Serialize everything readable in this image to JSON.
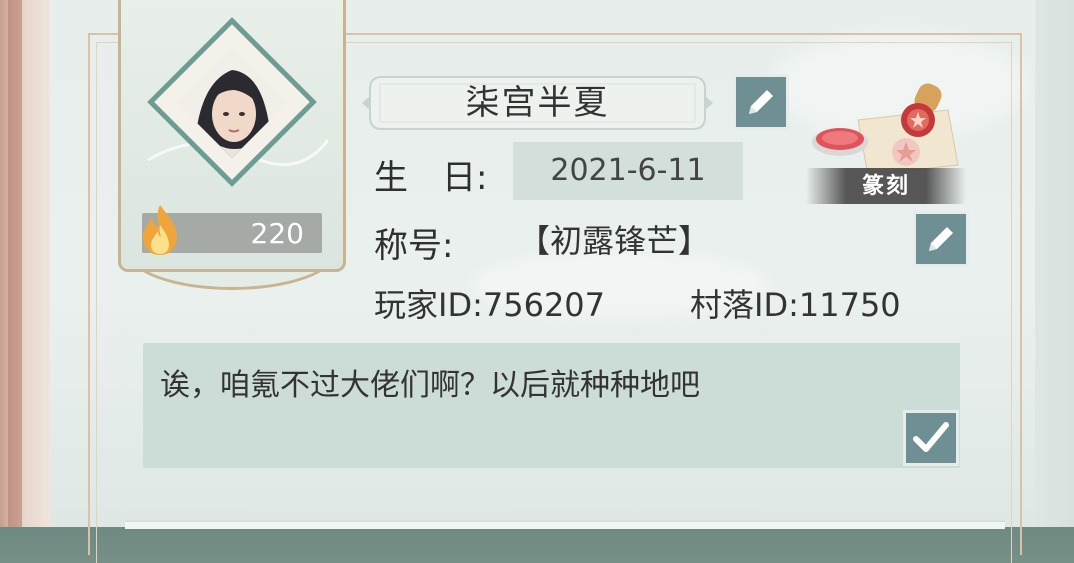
{
  "profile": {
    "name": "柒宫半夏",
    "level": "220",
    "birthday_label": "生　日:",
    "birthday": "2021-6-11",
    "title_label": "称号:",
    "title": "【初露锋芒】",
    "player_id_text": "玩家ID:756207",
    "village_id_text": "村落ID:11750",
    "signature": "诶，咱氪不过大佬们啊？以后就种种地吧"
  },
  "seal": {
    "label": "篆刻"
  },
  "icons": {
    "edit_name": "pencil-icon",
    "edit_title": "pencil-icon",
    "confirm": "checkmark-icon",
    "level": "flame-icon"
  },
  "colors": {
    "button": "#6e8f93",
    "field_bg": "#d3dfdb",
    "signature_bg": "#ccdcd7",
    "frame_gold": "#c9b48f",
    "avatar_border": "#6d9c93"
  }
}
